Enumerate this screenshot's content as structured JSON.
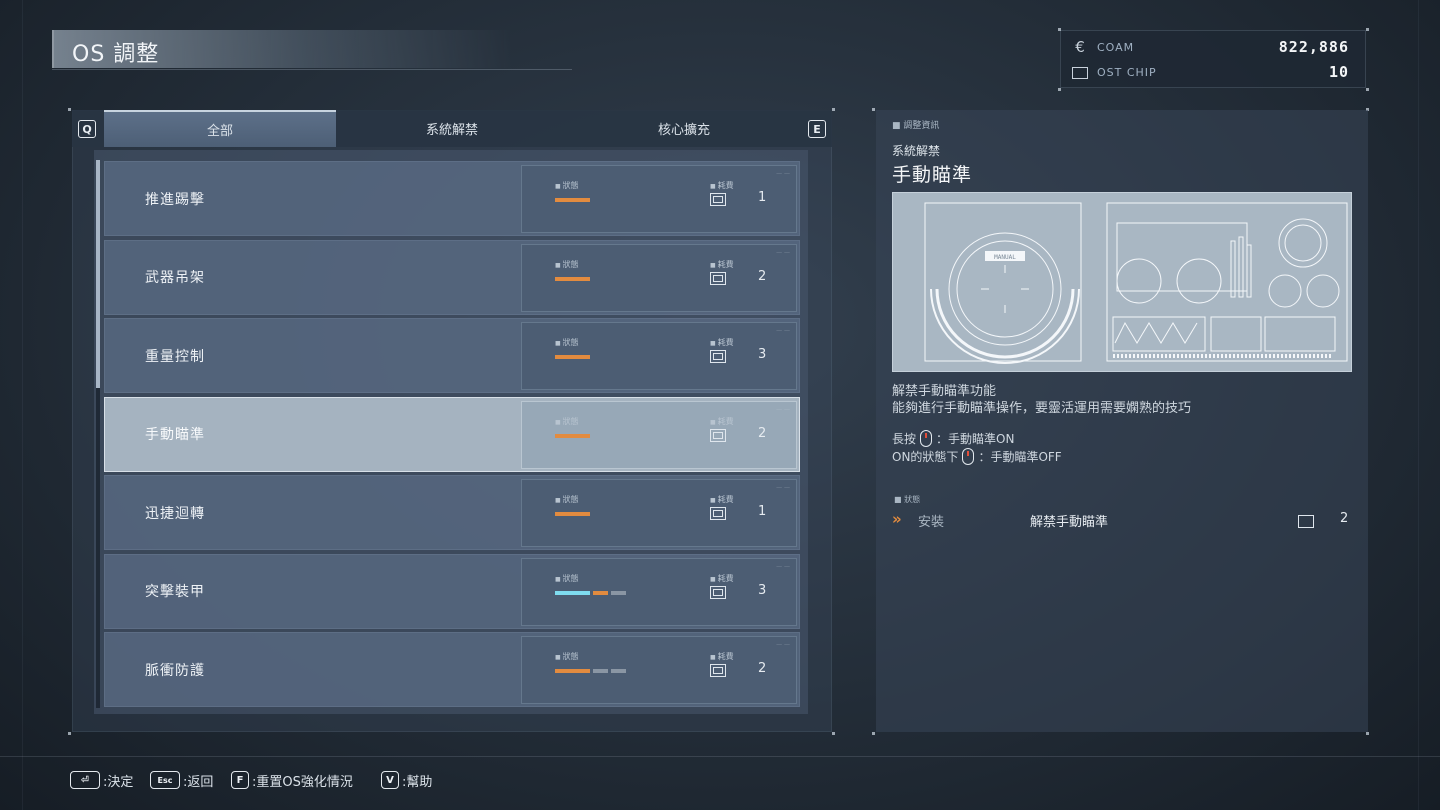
{
  "header": {
    "title": "OS 調整"
  },
  "currency": {
    "coam": {
      "icon": "coam-icon",
      "label": "COAM",
      "value": "822,886"
    },
    "ost_chip": {
      "icon": "chip-icon",
      "label": "OST CHIP",
      "value": "10"
    }
  },
  "tabs": {
    "prev_key": "Q",
    "next_key": "E",
    "items": [
      {
        "label": "全部",
        "active": true
      },
      {
        "label": "系統解禁",
        "active": false
      },
      {
        "label": "核心擴充",
        "active": false
      }
    ]
  },
  "list": {
    "status_label": "狀態",
    "cost_label": "耗費",
    "items": [
      {
        "name": "推進踢擊",
        "cost": "1",
        "bars": [
          "orange"
        ]
      },
      {
        "name": "武器吊架",
        "cost": "2",
        "bars": [
          "orange"
        ]
      },
      {
        "name": "重量控制",
        "cost": "3",
        "bars": [
          "orange"
        ]
      },
      {
        "name": "手動瞄準",
        "cost": "2",
        "bars": [
          "orange"
        ],
        "selected": true
      },
      {
        "name": "迅捷迴轉",
        "cost": "1",
        "bars": [
          "orange"
        ]
      },
      {
        "name": "突擊裝甲",
        "cost": "3",
        "bars": [
          "cyan",
          "orange-s",
          "grey-s"
        ]
      },
      {
        "name": "脈衝防護",
        "cost": "2",
        "bars": [
          "orange",
          "grey-s",
          "grey-s"
        ]
      }
    ]
  },
  "detail": {
    "section_label": "調整資訊",
    "category": "系統解禁",
    "title": "手動瞄準",
    "preview_badge": "MANUAL",
    "description": [
      "解禁手動瞄準功能",
      "能夠進行手動瞄準操作，要靈活運用需要嫻熟的技巧"
    ],
    "controls": [
      {
        "prefix": "長按",
        "suffix": "：手動瞄準ON"
      },
      {
        "prefix": "ON的狀態下",
        "suffix": "：手動瞄準OFF"
      }
    ],
    "status": {
      "label": "狀態",
      "state": "安裝",
      "name": "解禁手動瞄準",
      "cost": "2"
    }
  },
  "footer": {
    "confirm": {
      "key": "⏎",
      "label": ":決定"
    },
    "back": {
      "key": "Esc",
      "label": ":返回"
    },
    "reset": {
      "key": "F",
      "label": ":重置OS強化情況"
    },
    "help": {
      "key": "V",
      "label": ":幫助"
    }
  }
}
